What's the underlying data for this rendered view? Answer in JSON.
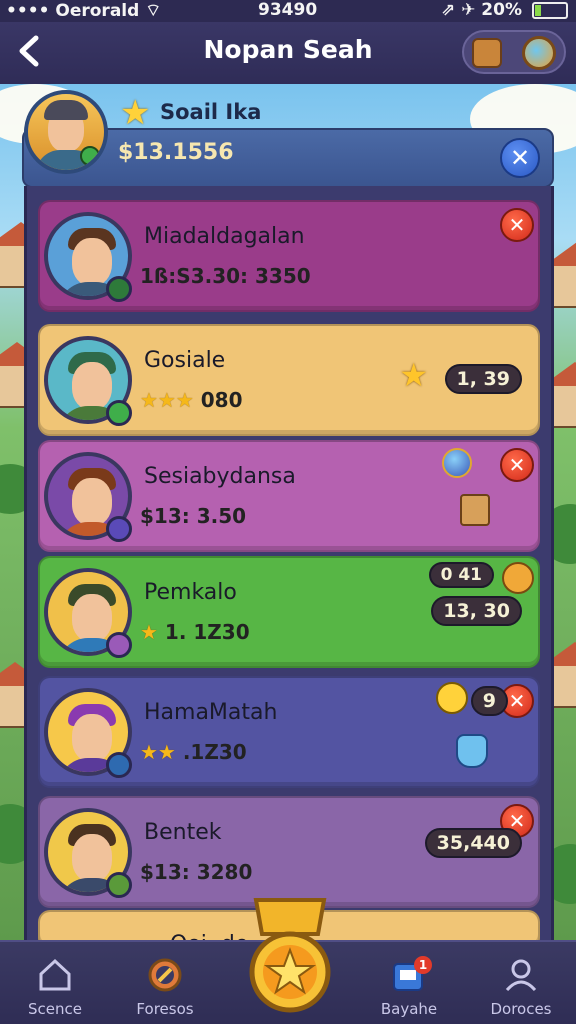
{
  "status_bar": {
    "carrier": "Oerorald",
    "time": "93490",
    "battery_text": "20%",
    "battery_level": 0.2
  },
  "header": {
    "title": "Nopan Seah",
    "back_icon": "chevron-left-icon",
    "action_icons": [
      "chest-icon",
      "compass-icon"
    ]
  },
  "profile": {
    "name": "Soail Ika",
    "score": "$13.1556",
    "star_icon": "star-icon",
    "close_icon": "close-icon"
  },
  "rows": [
    {
      "name": "Miadaldagalan",
      "score": "1ß:S3.30: 3350",
      "stars": "",
      "color": "#9a3c8a",
      "action_icon": "close-icon",
      "reward_text": "",
      "hair": "#5a3520",
      "shirt": "#3a5a7a",
      "bg": "#5aa0d8",
      "badge": "#2e7a3a"
    },
    {
      "name": "Gosiale",
      "score": "080",
      "stars": "★★★",
      "color": "#f0c576",
      "action_icon": "star-icon",
      "reward_text": "1, 39",
      "hair": "#2f6a4a",
      "shirt": "#4a7a3a",
      "bg": "#5ab8c8",
      "badge": "#3fae4a"
    },
    {
      "name": "Sesiabydansa",
      "score": "$13: 3.50",
      "stars": "",
      "color": "#b561b0",
      "action_icon": "close-icon",
      "reward_text": "",
      "hair": "#7a3a1a",
      "shirt": "#c25a2a",
      "bg": "#7a4aa8",
      "badge": "#5a4ab8"
    },
    {
      "name": "Pemkalo",
      "score": "1. 1Z30",
      "stars": "★",
      "color": "#57b645",
      "action_icon": "clock-icon",
      "reward_text": "13, 30",
      "reward_top": "0 41",
      "hair": "#3a4a2a",
      "shirt": "#2f7ab8",
      "bg": "#f0c04a",
      "badge": "#9a5ab8"
    },
    {
      "name": "HamaMatah",
      "score": ".1Z30",
      "stars": "★★",
      "color": "#5354a2",
      "action_icon": "close-icon",
      "reward_text": "9",
      "hair": "#8a3ab0",
      "shirt": "#5a3a9a",
      "bg": "#f6c84a",
      "badge": "#2e6ab0"
    },
    {
      "name": "Bentek",
      "score": "$13: 3280",
      "stars": "",
      "color": "#8a66a8",
      "action_icon": "close-icon",
      "reward_text": "35,440",
      "hair": "#4a3220",
      "shirt": "#3a4a6a",
      "bg": "#f0c84a",
      "badge": "#5a9a3a"
    }
  ],
  "partial_row": {
    "name": "Ooi .de",
    "color": "#f0c576"
  },
  "bottom_nav": [
    {
      "label": "Scence",
      "icon": "home-icon"
    },
    {
      "label": "Foresos",
      "icon": "compass-icon"
    },
    {
      "label": "",
      "icon": "star-badge-icon"
    },
    {
      "label": "Bayahe",
      "icon": "inbox-icon",
      "badge": "1"
    },
    {
      "label": "Doroces",
      "icon": "profile-icon"
    }
  ]
}
